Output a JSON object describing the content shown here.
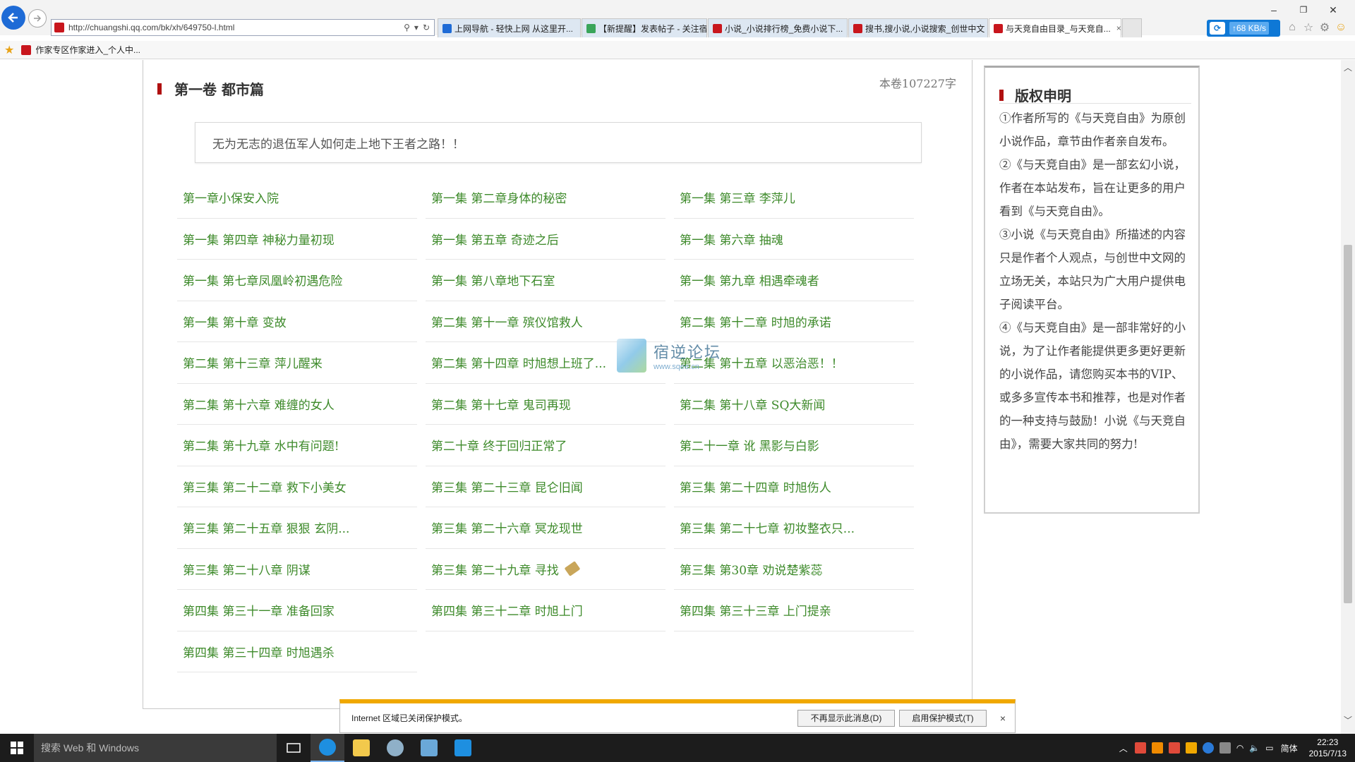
{
  "browser": {
    "url": "http://chuangshi.qq.com/bk/xh/649750-l.html",
    "tabs": [
      {
        "label": "上网导航 - 轻快上网 从这里开...",
        "icon_color": "#1e6bd6",
        "active": false,
        "width": 203
      },
      {
        "label": "【新提醒】发表帖子 - 关注宿...",
        "icon_color": "#3aa55a",
        "active": false,
        "width": 178
      },
      {
        "label": "小说_小说排行榜_免费小说下...",
        "icon_color": "#c8161d",
        "active": false,
        "width": 198
      },
      {
        "label": "搜书,搜小说,小说搜索_创世中文",
        "icon_color": "#c8161d",
        "active": false,
        "width": 198
      },
      {
        "label": "与天竞自由目录_与天竞自...",
        "icon_color": "#c8161d",
        "active": true,
        "width": 188
      }
    ],
    "tab_close": "×",
    "favorites": {
      "item_label": "作家专区作家进入_个人中..."
    },
    "speed": {
      "rate": "↑68 KB/s"
    },
    "window_controls": {
      "minimize": "–",
      "restore": "❐",
      "close": "✕"
    },
    "toolbar_icons": {
      "home": "⌂",
      "favorites": "☆",
      "settings": "⚙",
      "feedback": "☺"
    }
  },
  "page": {
    "volume_title": "第一卷 都市篇",
    "word_count": "本卷107227字",
    "description": "无为无志的退伍军人如何走上地下王者之路！！",
    "chapters": [
      "第一章小保安入院",
      "第一集 第二章身体的秘密",
      "第一集 第三章 李萍儿",
      "第一集 第四章 神秘力量初现",
      "第一集 第五章 奇迹之后",
      "第一集 第六章 抽魂",
      "第一集 第七章凤凰岭初遇危险",
      "第一集 第八章地下石室",
      "第一集 第九章 相遇牵魂者",
      "第一集 第十章 变故",
      "第二集 第十一章 殡仪馆救人",
      "第二集 第十二章 时旭的承诺",
      "第二集 第十三章 萍儿醒来",
      "第二集 第十四章 时旭想上班了...",
      "第二集 第十五章 以恶治恶！！",
      "第二集 第十六章 难缠的女人",
      "第二集 第十七章 鬼司再现",
      "第二集 第十八章 SQ大新闻",
      "第二集 第十九章 水中有问题!",
      "第二十章 终于回归正常了",
      "第二十一章 讹 黑影与白影",
      "第三集 第二十二章 救下小美女",
      "第三集 第二十三章 昆仑旧闻",
      "第三集 第二十四章 时旭伤人",
      "第三集 第二十五章 狠狠 玄阴...",
      "第三集 第二十六章 冥龙现世",
      "第三集 第二十七章 初妆整衣只...",
      "第三集 第二十八章 阴谋",
      "第三集 第二十九章 寻找",
      "第三集 第30章 劝说楚紫蕊",
      "第四集 第三十一章 准备回家",
      "第四集 第三十二章 时旭上门",
      "第四集 第三十三章 上门提亲",
      "第四集 第三十四章 时旭遇杀"
    ]
  },
  "sidebar": {
    "title": "版权申明",
    "paragraphs": [
      "①作者所写的《与天竞自由》为原创小说作品，章节由作者亲自发布。",
      "②《与天竞自由》是一部玄幻小说，作者在本站发布，旨在让更多的用户看到《与天竞自由》。",
      "③小说《与天竞自由》所描述的内容只是作者个人观点，与创世中文网的立场无关，本站只为广大用户提供电子阅读平台。",
      "④《与天竞自由》是一部非常好的小说，为了让作者能提供更多更好更新的小说作品，请您购买本书的VIP、或多多宣传本书和推荐，也是对作者的一种支持与鼓励！小说《与天竞自由》，需要大家共同的努力!"
    ]
  },
  "watermark": {
    "text": "宿逆论坛",
    "url": "www.sqee.cn"
  },
  "notification": {
    "message": "Internet 区域已关闭保护模式。",
    "dismiss_label": "不再显示此消息(D)",
    "enable_label": "启用保护模式(T)",
    "close": "×"
  },
  "taskbar": {
    "search_placeholder": "搜索 Web 和 Windows",
    "ime": "简体",
    "time": "22:23",
    "date": "2015/7/13"
  },
  "colors": {
    "accent_red": "#b01010",
    "chapter_green": "#3d8a2a",
    "ie_blue": "#1e6bd6"
  }
}
